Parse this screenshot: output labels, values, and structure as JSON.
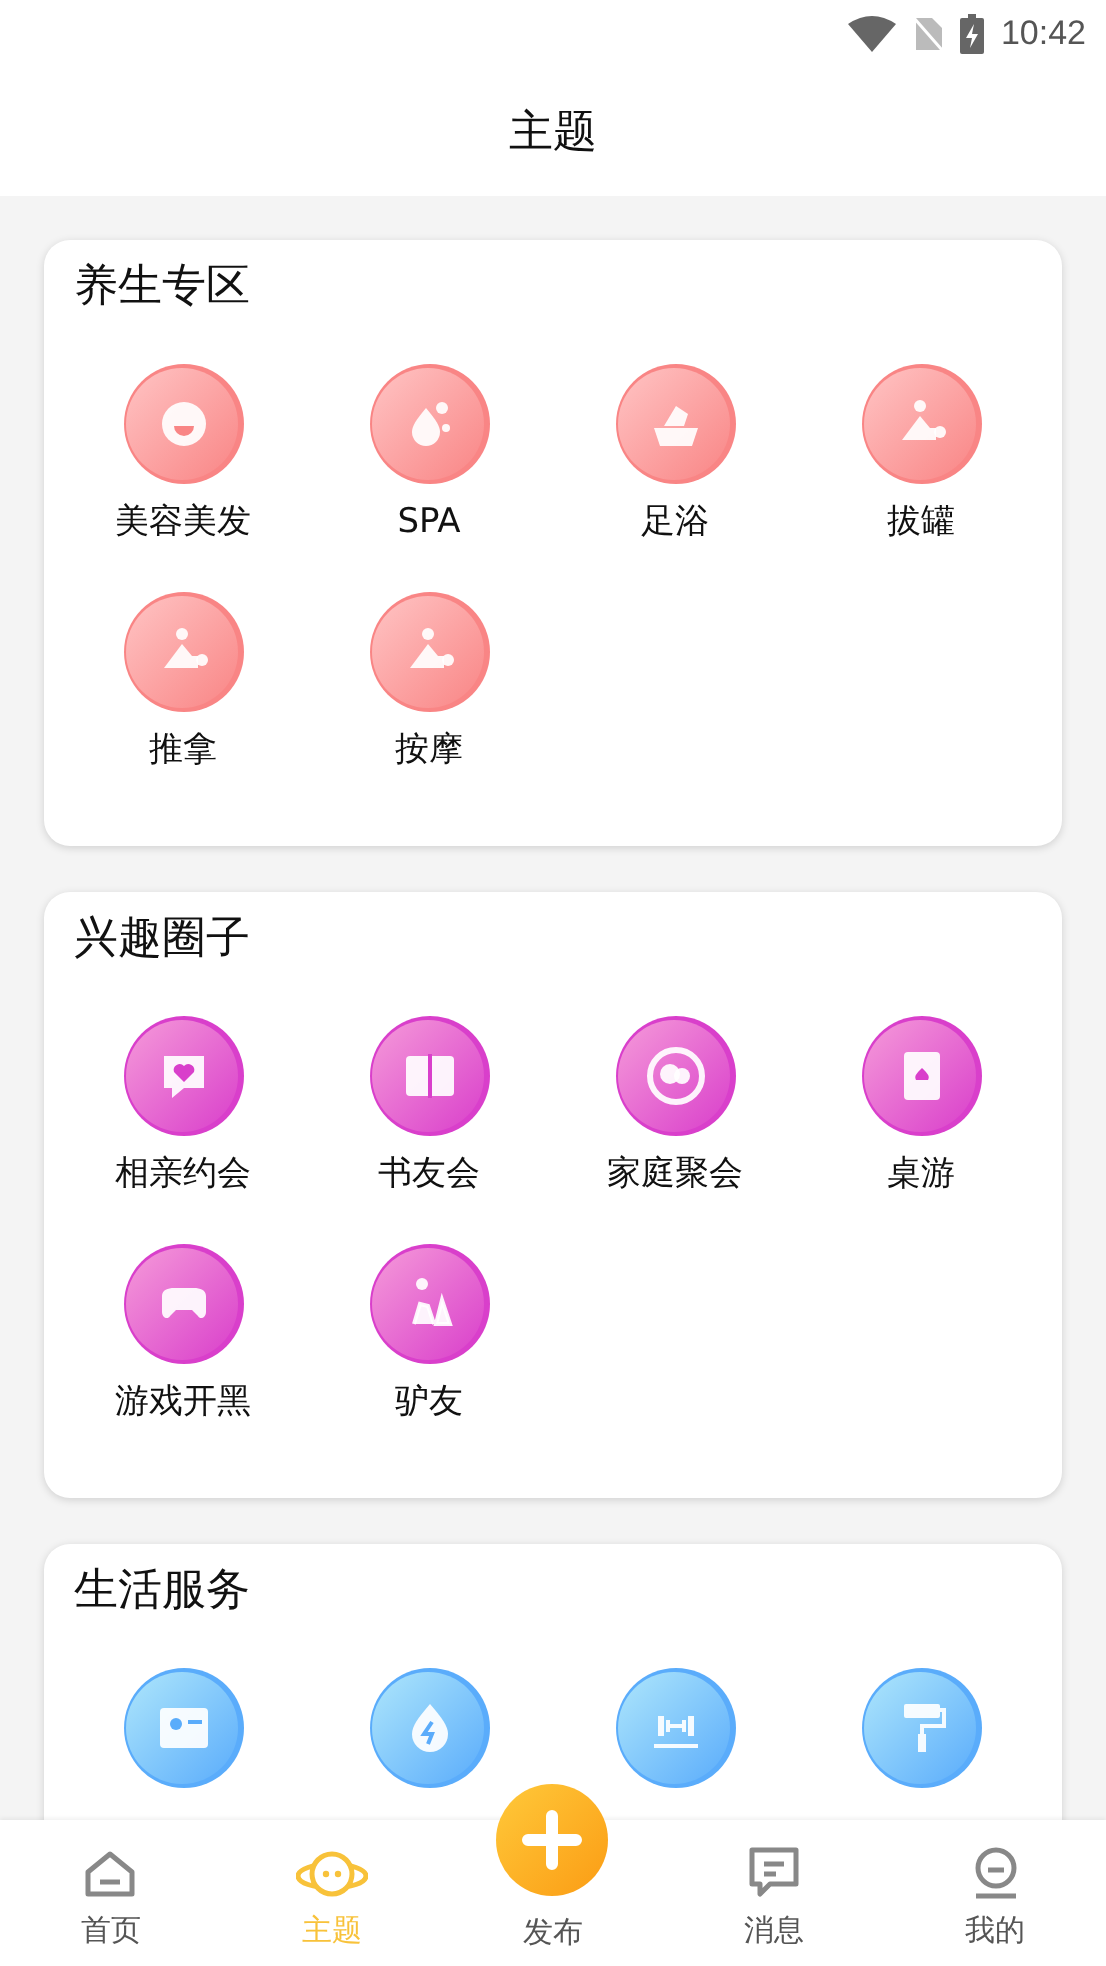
{
  "status_bar": {
    "time": "10:42"
  },
  "header": {
    "title": "主题"
  },
  "sections": [
    {
      "title": "养生专区",
      "color": "#f98585",
      "items": [
        {
          "label": "美容美发"
        },
        {
          "label": "SPA"
        },
        {
          "label": "足浴"
        },
        {
          "label": "拔罐"
        },
        {
          "label": "推拿"
        },
        {
          "label": "按摩"
        }
      ]
    },
    {
      "title": "兴趣圈子",
      "color": "#d93fcb",
      "items": [
        {
          "label": "相亲约会"
        },
        {
          "label": "书友会"
        },
        {
          "label": "家庭聚会"
        },
        {
          "label": "桌游"
        },
        {
          "label": "游戏开黑"
        },
        {
          "label": "驴友"
        }
      ]
    },
    {
      "title": "生活服务",
      "color": "#5aacfb"
    }
  ],
  "tab_bar": [
    {
      "label": "首页",
      "kind": "tab",
      "selected": false
    },
    {
      "label": "主题",
      "kind": "tab",
      "selected": true
    },
    {
      "label": "发布",
      "kind": "publish",
      "selected": false
    },
    {
      "label": "消息",
      "kind": "tab",
      "selected": false
    },
    {
      "label": "我的",
      "kind": "tab",
      "selected": false
    }
  ]
}
